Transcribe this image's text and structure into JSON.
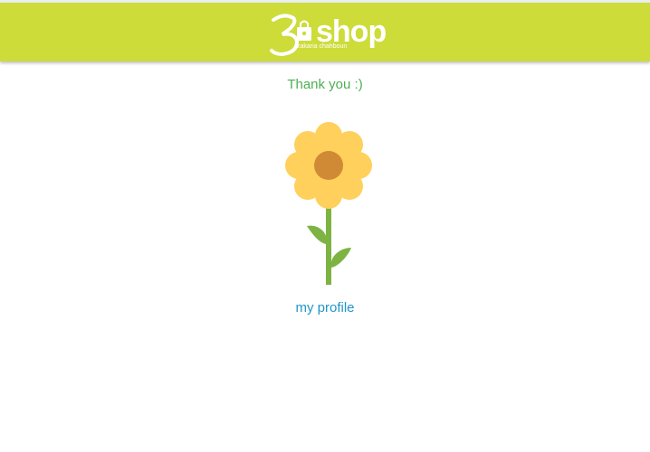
{
  "header": {
    "logo_text": "shop",
    "logo_subtitle": "zakaria chahboun",
    "background_color": "#cddc39"
  },
  "main": {
    "message": "Thank you :)",
    "illustration_icon": "sunflower-icon",
    "profile_link_label": "my profile"
  },
  "colors": {
    "message_text": "#4caf50",
    "link_text": "#2196c9",
    "petal": "#ffd05b",
    "flower_center": "#d08a35",
    "stem": "#7cb342"
  }
}
